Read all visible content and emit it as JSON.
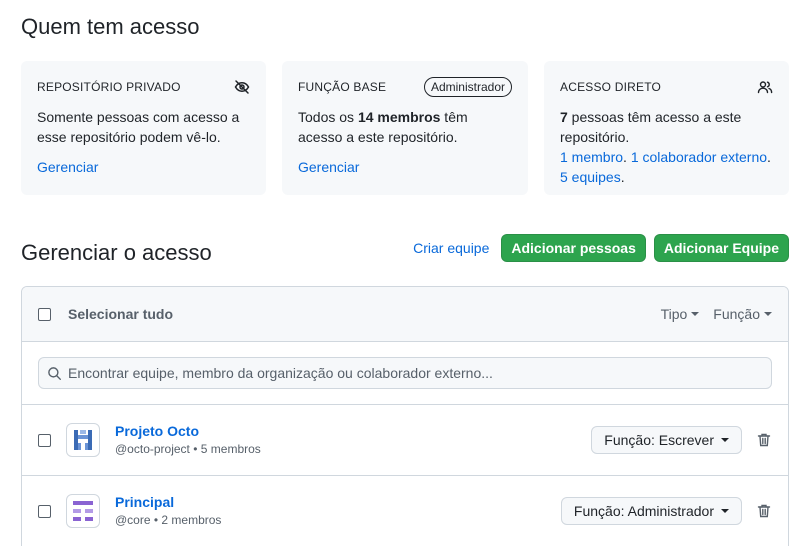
{
  "access": {
    "title": "Quem tem acesso",
    "cards": [
      {
        "label": "REPOSITÓRIO PRIVADO",
        "icon": "eye-closed-icon",
        "text": "Somente pessoas com acesso a esse repositório podem vê-lo.",
        "link": "Gerenciar"
      },
      {
        "label": "FUNÇÃO BASE",
        "badge": "Administrador",
        "text_pre": "Todos os ",
        "text_bold": "14 membros",
        "text_post": " têm acesso a este repositório.",
        "link": "Gerenciar"
      },
      {
        "label": "ACESSO DIRETO",
        "icon": "people-icon",
        "count": "7",
        "text": " pessoas têm acesso a este repositório.",
        "link_members": "1 membro",
        "link_collaborators": "1 colaborador externo",
        "link_teams": "5 equipes",
        "sep": ".",
        "end": "."
      }
    ]
  },
  "manage": {
    "title": "Gerenciar o acesso",
    "create_team": "Criar equipe",
    "add_people": "Adicionar pessoas",
    "add_team": "Adicionar Equipe"
  },
  "table": {
    "select_all": "Selecionar tudo",
    "filter_type": "Tipo",
    "filter_role": "Função",
    "search_placeholder": "Encontrar equipe, membro da organização ou colaborador externo...",
    "rows": [
      {
        "name": "Projeto Octo",
        "handle": "@octo-project",
        "members": "5 membros",
        "role": "Função: Escrever",
        "avatar_color": "#3b6bb5"
      },
      {
        "name": "Principal",
        "handle": "@core",
        "members": "2 membros",
        "role": "Função: Administrador",
        "avatar_color": "#8a63d2"
      }
    ]
  },
  "colors": {
    "link": "#0969da",
    "primary": "#2da44e",
    "muted": "#57606a"
  }
}
